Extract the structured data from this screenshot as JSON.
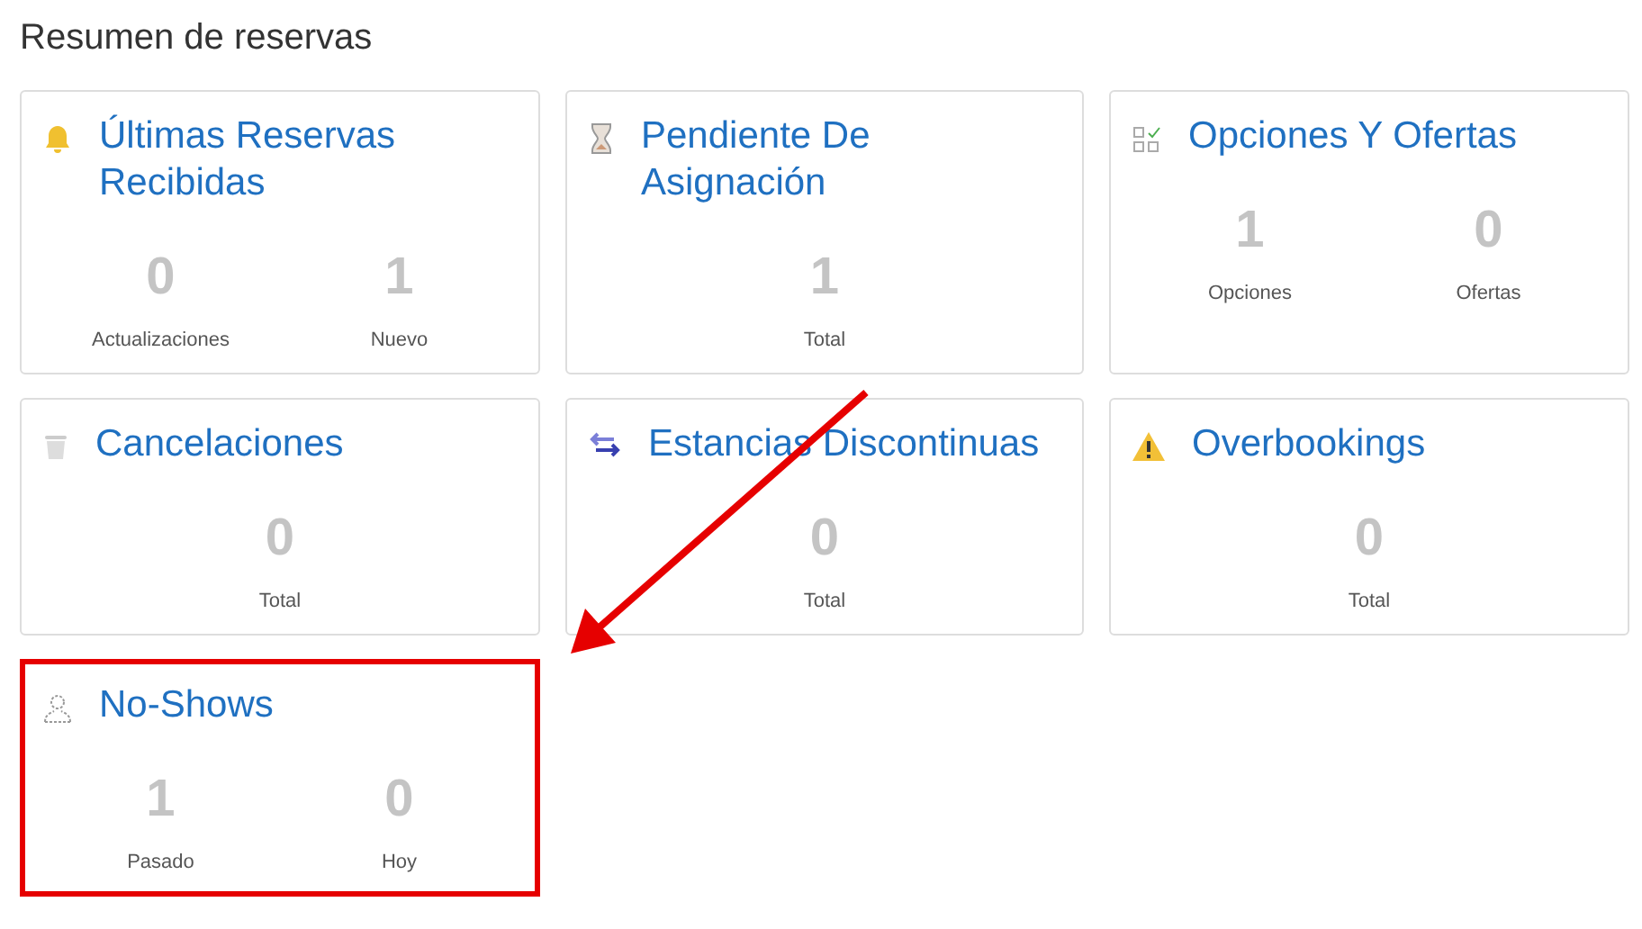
{
  "title": "Resumen de reservas",
  "cards": [
    {
      "title": "Últimas Reservas Recibidas",
      "highlighted": false,
      "stats": [
        {
          "value": "0",
          "label": "Actualizaciones"
        },
        {
          "value": "1",
          "label": "Nuevo"
        }
      ]
    },
    {
      "title": "Pendiente De Asignación",
      "highlighted": false,
      "stats": [
        {
          "value": "1",
          "label": "Total"
        }
      ]
    },
    {
      "title": "Opciones Y Ofertas",
      "highlighted": false,
      "stats": [
        {
          "value": "1",
          "label": "Opciones"
        },
        {
          "value": "0",
          "label": "Ofertas"
        }
      ]
    },
    {
      "title": "Cancelaciones",
      "highlighted": false,
      "stats": [
        {
          "value": "0",
          "label": "Total"
        }
      ]
    },
    {
      "title": "Estancias Discontinuas",
      "highlighted": false,
      "stats": [
        {
          "value": "0",
          "label": "Total"
        }
      ]
    },
    {
      "title": "Overbookings",
      "highlighted": false,
      "stats": [
        {
          "value": "0",
          "label": "Total"
        }
      ]
    },
    {
      "title": "No-Shows",
      "highlighted": true,
      "stats": [
        {
          "value": "1",
          "label": "Pasado"
        },
        {
          "value": "0",
          "label": "Hoy"
        }
      ]
    }
  ]
}
